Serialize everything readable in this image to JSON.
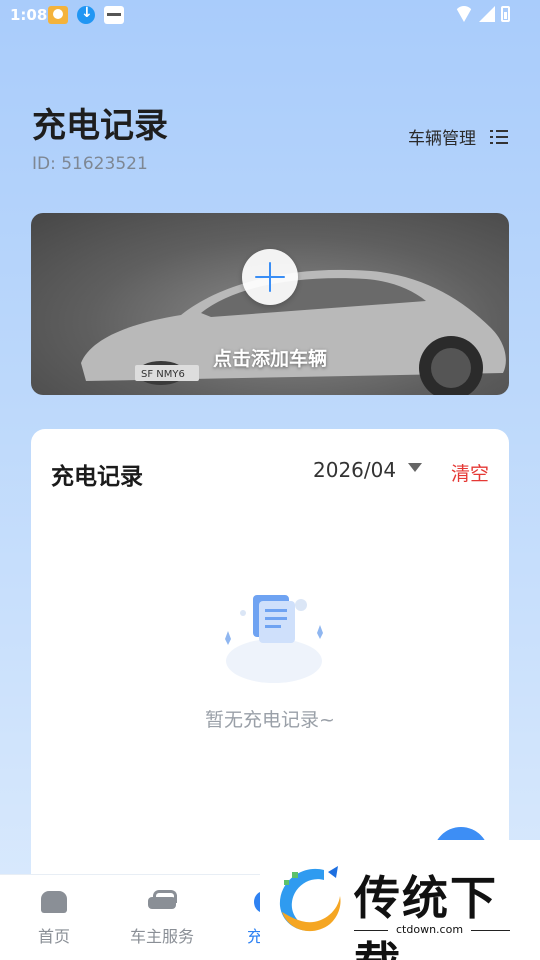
{
  "status_bar": {
    "time": "1:08",
    "notification_icons": [
      "app-notification-icon",
      "download-icon",
      "card-notification-icon"
    ],
    "system_icons": [
      "wifi-icon",
      "signal-icon",
      "battery-icon"
    ]
  },
  "header": {
    "title": "充电记录",
    "user_id": "ID: 51623521",
    "vehicle_management_label": "车辆管理",
    "vehicle_management_icon": "list-icon"
  },
  "add_vehicle": {
    "label": "点击添加车辆",
    "icon": "plus-icon",
    "plate_text": "SF NMY6"
  },
  "records": {
    "title": "充电记录",
    "month": "2026/04",
    "clear_label": "清空",
    "empty_text": "暂无充电记录~",
    "empty_icon": "empty-document-icon"
  },
  "bottom_nav": {
    "items": [
      {
        "label": "首页",
        "icon": "home-icon",
        "active": false
      },
      {
        "label": "车主服务",
        "icon": "car-icon",
        "active": false
      },
      {
        "label": "充电",
        "icon": "charge-icon",
        "active": true
      }
    ]
  },
  "watermark": {
    "text": "传统下载",
    "url": "ctdown.com"
  },
  "colors": {
    "accent": "#2f82f2",
    "danger": "#e53935",
    "background_top": "#a9ccfb",
    "muted_text": "#9aa0a8"
  }
}
